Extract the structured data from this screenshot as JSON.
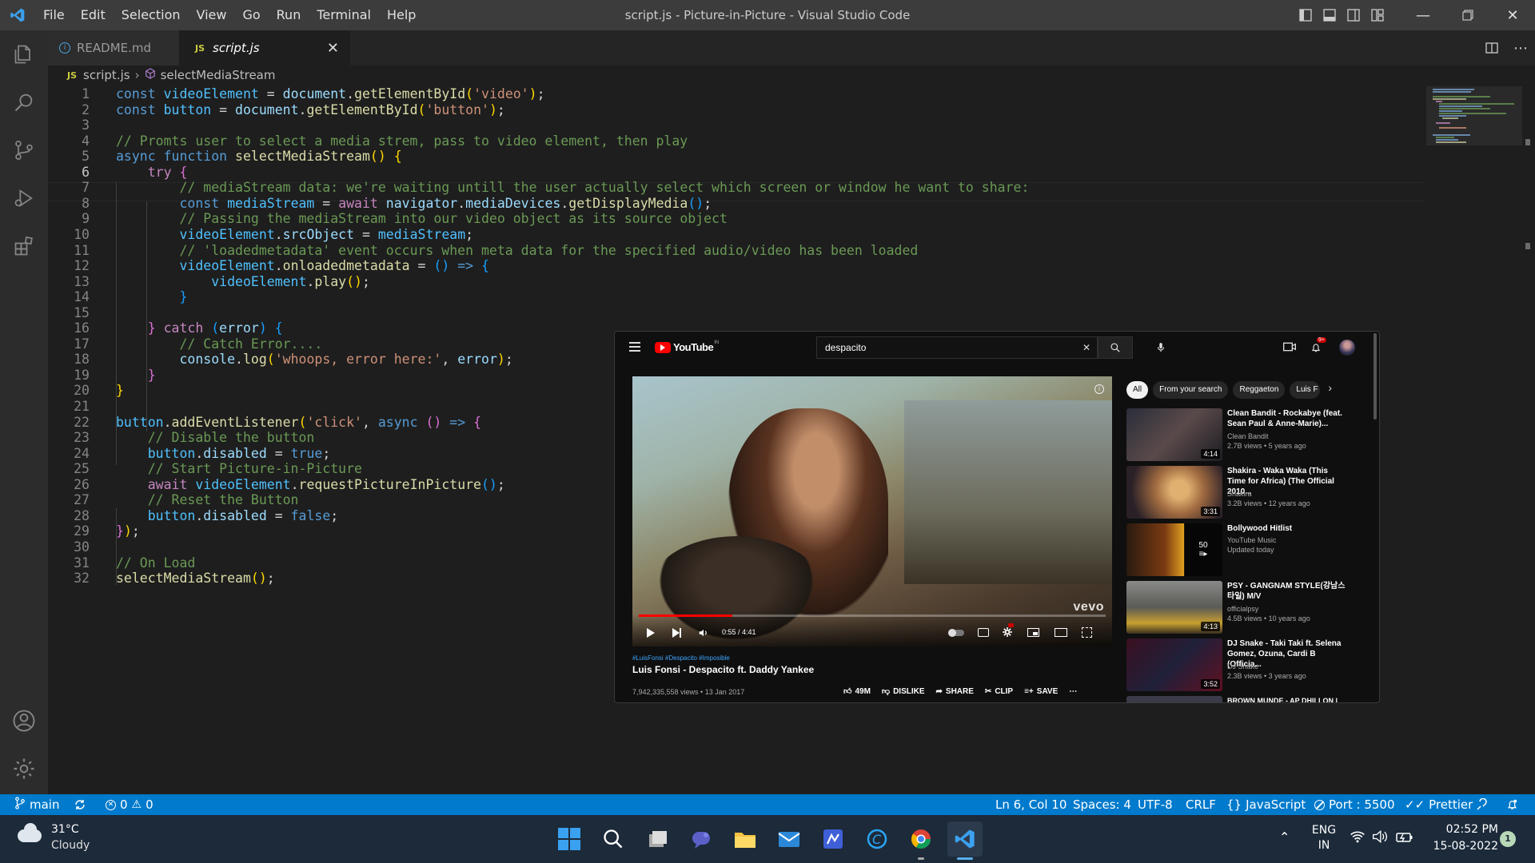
{
  "window": {
    "title": "script.js - Picture-in-Picture - Visual Studio Code"
  },
  "menu": [
    "File",
    "Edit",
    "Selection",
    "View",
    "Go",
    "Run",
    "Terminal",
    "Help"
  ],
  "tabs": [
    {
      "label": "README.md",
      "icon": "info-icon",
      "active": false
    },
    {
      "label": "script.js",
      "icon": "js-icon",
      "icon_text": "JS",
      "active": true
    }
  ],
  "breadcrumb": {
    "icon_text": "JS",
    "file": "script.js",
    "symbol": "selectMediaStream"
  },
  "editor": {
    "line_numbers": [
      "1",
      "2",
      "3",
      "4",
      "5",
      "6",
      "7",
      "8",
      "9",
      "10",
      "11",
      "12",
      "13",
      "14",
      "15",
      "16",
      "17",
      "18",
      "19",
      "20",
      "21",
      "22",
      "23",
      "24",
      "25",
      "26",
      "27",
      "28",
      "29",
      "30",
      "31",
      "32"
    ],
    "active_line": "6",
    "code": [
      [
        [
          "kw",
          "const"
        ],
        [
          "",
          " "
        ],
        [
          "cls",
          "videoElement"
        ],
        [
          "",
          " = "
        ],
        [
          "var",
          "document"
        ],
        [
          "",
          "."
        ],
        [
          "fn",
          "getElementById"
        ],
        [
          "br1",
          "("
        ],
        [
          "str",
          "'video'"
        ],
        [
          "br1",
          ")"
        ],
        [
          "",
          ";"
        ]
      ],
      [
        [
          "kw",
          "const"
        ],
        [
          "",
          " "
        ],
        [
          "cls",
          "button"
        ],
        [
          "",
          " = "
        ],
        [
          "var",
          "document"
        ],
        [
          "",
          "."
        ],
        [
          "fn",
          "getElementById"
        ],
        [
          "br1",
          "("
        ],
        [
          "str",
          "'button'"
        ],
        [
          "br1",
          ")"
        ],
        [
          "",
          ";"
        ]
      ],
      [],
      [
        [
          "cm",
          "// Promts user to select a media strem, pass to video element, then play"
        ]
      ],
      [
        [
          "kw",
          "async"
        ],
        [
          "",
          " "
        ],
        [
          "kw",
          "function"
        ],
        [
          "",
          " "
        ],
        [
          "fn",
          "selectMediaStream"
        ],
        [
          "br1",
          "()"
        ],
        [
          "",
          " "
        ],
        [
          "br1",
          "{"
        ]
      ],
      [
        [
          "",
          "    "
        ],
        [
          "ctl",
          "try"
        ],
        [
          "",
          " "
        ],
        [
          "br2",
          "{"
        ]
      ],
      [
        [
          "",
          "        "
        ],
        [
          "cm",
          "// mediaStream data: we're waiting untill the user actually select which screen or window he want to share:"
        ]
      ],
      [
        [
          "",
          "        "
        ],
        [
          "kw",
          "const"
        ],
        [
          "",
          " "
        ],
        [
          "cls",
          "mediaStream"
        ],
        [
          "",
          " = "
        ],
        [
          "ctl",
          "await"
        ],
        [
          "",
          " "
        ],
        [
          "var",
          "navigator"
        ],
        [
          "",
          "."
        ],
        [
          "var",
          "mediaDevices"
        ],
        [
          "",
          "."
        ],
        [
          "fn",
          "getDisplayMedia"
        ],
        [
          "br3",
          "()"
        ],
        [
          "",
          ";"
        ]
      ],
      [
        [
          "",
          "        "
        ],
        [
          "cm",
          "// Passing the mediaStream into our video object as its source object"
        ]
      ],
      [
        [
          "",
          "        "
        ],
        [
          "cls",
          "videoElement"
        ],
        [
          "",
          "."
        ],
        [
          "var",
          "srcObject"
        ],
        [
          "",
          " = "
        ],
        [
          "cls",
          "mediaStream"
        ],
        [
          "",
          ";"
        ]
      ],
      [
        [
          "",
          "        "
        ],
        [
          "cm",
          "// 'loadedmetadata' event occurs when meta data for the specified audio/video has been loaded"
        ]
      ],
      [
        [
          "",
          "        "
        ],
        [
          "cls",
          "videoElement"
        ],
        [
          "",
          "."
        ],
        [
          "fn",
          "onloadedmetadata"
        ],
        [
          "",
          " = "
        ],
        [
          "br3",
          "()"
        ],
        [
          "",
          " "
        ],
        [
          "kw",
          "=>"
        ],
        [
          "",
          " "
        ],
        [
          "br3",
          "{"
        ]
      ],
      [
        [
          "",
          "            "
        ],
        [
          "cls",
          "videoElement"
        ],
        [
          "",
          "."
        ],
        [
          "fn",
          "play"
        ],
        [
          "br1",
          "()"
        ],
        [
          "",
          ";"
        ]
      ],
      [
        [
          "",
          "        "
        ],
        [
          "br3",
          "}"
        ]
      ],
      [],
      [
        [
          "",
          "    "
        ],
        [
          "br2",
          "}"
        ],
        [
          "",
          " "
        ],
        [
          "ctl",
          "catch"
        ],
        [
          "",
          " "
        ],
        [
          "br3",
          "("
        ],
        [
          "var",
          "error"
        ],
        [
          "br3",
          ")"
        ],
        [
          "",
          " "
        ],
        [
          "br3",
          "{"
        ]
      ],
      [
        [
          "",
          "        "
        ],
        [
          "cm",
          "// Catch Error...."
        ]
      ],
      [
        [
          "",
          "        "
        ],
        [
          "var",
          "console"
        ],
        [
          "",
          "."
        ],
        [
          "fn",
          "log"
        ],
        [
          "br1",
          "("
        ],
        [
          "str",
          "'whoops, error here:'"
        ],
        [
          "",
          ", "
        ],
        [
          "var",
          "error"
        ],
        [
          "br1",
          ")"
        ],
        [
          "",
          ";"
        ]
      ],
      [
        [
          "",
          "    "
        ],
        [
          "br2",
          "}"
        ]
      ],
      [
        [
          "br1",
          "}"
        ]
      ],
      [],
      [
        [
          "cls",
          "button"
        ],
        [
          "",
          "."
        ],
        [
          "fn",
          "addEventListener"
        ],
        [
          "br1",
          "("
        ],
        [
          "str",
          "'click'"
        ],
        [
          "",
          ", "
        ],
        [
          "kw",
          "async"
        ],
        [
          "",
          " "
        ],
        [
          "br2",
          "()"
        ],
        [
          "",
          " "
        ],
        [
          "kw",
          "=>"
        ],
        [
          "",
          " "
        ],
        [
          "br2",
          "{"
        ]
      ],
      [
        [
          "",
          "    "
        ],
        [
          "cm",
          "// Disable the button"
        ]
      ],
      [
        [
          "",
          "    "
        ],
        [
          "cls",
          "button"
        ],
        [
          "",
          "."
        ],
        [
          "var",
          "disabled"
        ],
        [
          "",
          " = "
        ],
        [
          "kw",
          "true"
        ],
        [
          "",
          ";"
        ]
      ],
      [
        [
          "",
          "    "
        ],
        [
          "cm",
          "// Start Picture-in-Picture"
        ]
      ],
      [
        [
          "",
          "    "
        ],
        [
          "ctl",
          "await"
        ],
        [
          "",
          " "
        ],
        [
          "cls",
          "videoElement"
        ],
        [
          "",
          "."
        ],
        [
          "fn",
          "requestPictureInPicture"
        ],
        [
          "br3",
          "()"
        ],
        [
          "",
          ";"
        ]
      ],
      [
        [
          "",
          "    "
        ],
        [
          "cm",
          "// Reset the Button"
        ]
      ],
      [
        [
          "",
          "    "
        ],
        [
          "cls",
          "button"
        ],
        [
          "",
          "."
        ],
        [
          "var",
          "disabled"
        ],
        [
          "",
          " = "
        ],
        [
          "kw",
          "false"
        ],
        [
          "",
          ";"
        ]
      ],
      [
        [
          "br2",
          "}"
        ],
        [
          "br1",
          ")"
        ],
        [
          "",
          ";"
        ]
      ],
      [],
      [
        [
          "cm",
          "// On Load"
        ]
      ],
      [
        [
          "fn",
          "selectMediaStream"
        ],
        [
          "br1",
          "()"
        ],
        [
          "",
          ";"
        ]
      ]
    ]
  },
  "youtube": {
    "logo_text": "YouTube",
    "region": "IN",
    "search_value": "despacito",
    "notification_count": "9+",
    "player": {
      "time": "0:55 / 4:41",
      "progress": 0.2,
      "watermark": "vevo"
    },
    "video": {
      "hashtags": "#LuisFonsi #Despacito #Imposible",
      "title": "Luis Fonsi - Despacito ft. Daddy Yankee",
      "stats": "7,942,335,558 views • 13 Jan 2017",
      "likes": "49M",
      "dislike": "DISLIKE",
      "share": "SHARE",
      "clip": "CLIP",
      "save": "SAVE"
    },
    "chips": [
      "All",
      "From your search",
      "Reggaeton",
      "Luis F"
    ],
    "recommendations": [
      {
        "title": "Clean Bandit - Rockabye (feat. Sean Paul & Anne-Marie)...",
        "channel": "Clean Bandit",
        "meta": "2.7B views • 5 years ago",
        "duration": "4:14"
      },
      {
        "title": "Shakira - Waka Waka (This Time for Africa) (The Official 2010...",
        "channel": "Shakira",
        "meta": "3.2B views • 12 years ago",
        "duration": "3:31"
      },
      {
        "title": "Bollywood Hitlist",
        "channel": "YouTube Music",
        "meta": "Updated today",
        "playlist_count": "50"
      },
      {
        "title": "PSY - GANGNAM STYLE(강남스타일) M/V",
        "channel": "officialpsy",
        "meta": "4.5B views • 10 years ago",
        "duration": "4:13"
      },
      {
        "title": "DJ Snake - Taki Taki ft. Selena Gomez, Ozuna, Cardi B (Officia...",
        "channel": "DJ Snake",
        "meta": "2.3B views • 3 years ago",
        "duration": "3:52"
      },
      {
        "title": "BROWN MUNDE - AP DHILLON |",
        "channel": "",
        "meta": "",
        "duration": ""
      }
    ]
  },
  "status": {
    "branch": "main",
    "errors": "0",
    "warnings": "0",
    "position": "Ln 6, Col 10",
    "spaces": "Spaces: 4",
    "encoding": "UTF-8",
    "eol": "CRLF",
    "language": "JavaScript",
    "port": "Port : 5500",
    "formatter": "Prettier"
  },
  "taskbar": {
    "weather_temp": "31°C",
    "weather_desc": "Cloudy",
    "lang": "ENG",
    "region": "IN",
    "time": "02:52 PM",
    "date": "15-08-2022",
    "notification_count": "1",
    "apps": [
      "windows-start",
      "search",
      "task-view",
      "teams-chat",
      "file-explorer",
      "mail",
      "visual-studio",
      "cortana",
      "chrome",
      "vscode"
    ]
  },
  "colors": {
    "accent": "#007acc",
    "titlebar": "#3c3c3c",
    "editor_bg": "#1e1e1e",
    "yt_red": "#ff0000"
  }
}
